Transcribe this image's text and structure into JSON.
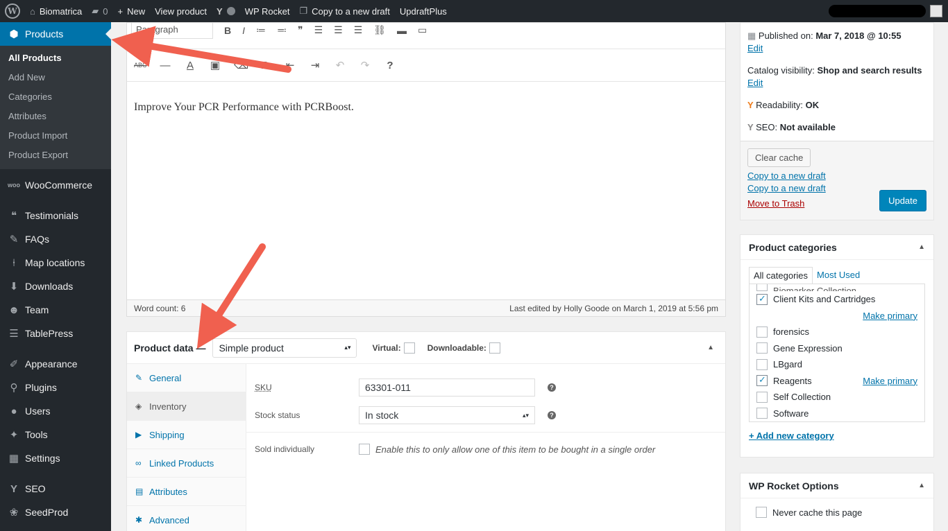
{
  "admin_bar": {
    "site_name": "Biomatrica",
    "comments_count": "0",
    "new_label": "New",
    "view_product": "View product",
    "wp_rocket": "WP Rocket",
    "copy_draft": "Copy to a new draft",
    "updraft": "UpdraftPlus"
  },
  "sidebar": {
    "products": "Products",
    "submenu": [
      "All Products",
      "Add New",
      "Categories",
      "Attributes",
      "Product Import",
      "Product Export"
    ],
    "items": [
      "WooCommerce",
      "Testimonials",
      "FAQs",
      "Map locations",
      "Downloads",
      "Team",
      "TablePress",
      "Appearance",
      "Plugins",
      "Users",
      "Tools",
      "Settings",
      "SEO",
      "SeedProd"
    ]
  },
  "editor": {
    "format_select": "Paragraph",
    "content": "Improve Your PCR Performance with PCRBoost.",
    "word_count": "Word count: 6",
    "last_edited": "Last edited by Holly Goode on March 1, 2019 at 5:56 pm"
  },
  "product_data": {
    "title": "Product data —",
    "type": "Simple product",
    "virtual_label": "Virtual:",
    "downloadable_label": "Downloadable:",
    "tabs": [
      "General",
      "Inventory",
      "Shipping",
      "Linked Products",
      "Attributes",
      "Advanced"
    ],
    "sku_label": "SKU",
    "sku_value": "63301-011",
    "stock_label": "Stock status",
    "stock_value": "In stock",
    "sold_label": "Sold individually",
    "sold_desc": "Enable this to only allow one of this item to be bought in a single order"
  },
  "publish": {
    "published_label": "Published on: ",
    "published_date": "Mar 7, 2018 @ 10:55",
    "edit": "Edit",
    "catalog_label": "Catalog visibility: ",
    "catalog_value": "Shop and search results",
    "readability_label": "Readability: ",
    "readability_value": "OK",
    "seo_label": "SEO: ",
    "seo_value": "Not available",
    "clear_cache": "Clear cache",
    "copy_draft_1": "Copy to a new draft",
    "copy_draft_2": "Copy to a new draft",
    "trash": "Move to Trash",
    "update": "Update"
  },
  "categories": {
    "title": "Product categories",
    "tab_all": "All categories",
    "tab_used": "Most Used",
    "partial_top": "Biomarker Collection",
    "items": [
      "Client Kits and Cartridges",
      "forensics",
      "Gene Expression",
      "LBgard",
      "Reagents",
      "Self Collection",
      "Software"
    ],
    "make_primary": "Make primary",
    "add_new": "+ Add new category"
  },
  "rocket": {
    "title": "WP Rocket Options",
    "never_cache": "Never cache this page"
  },
  "colors": {
    "accent": "#0073aa",
    "admin_bar": "#23282d",
    "arrow": "#f0604f",
    "trash": "#a00"
  }
}
